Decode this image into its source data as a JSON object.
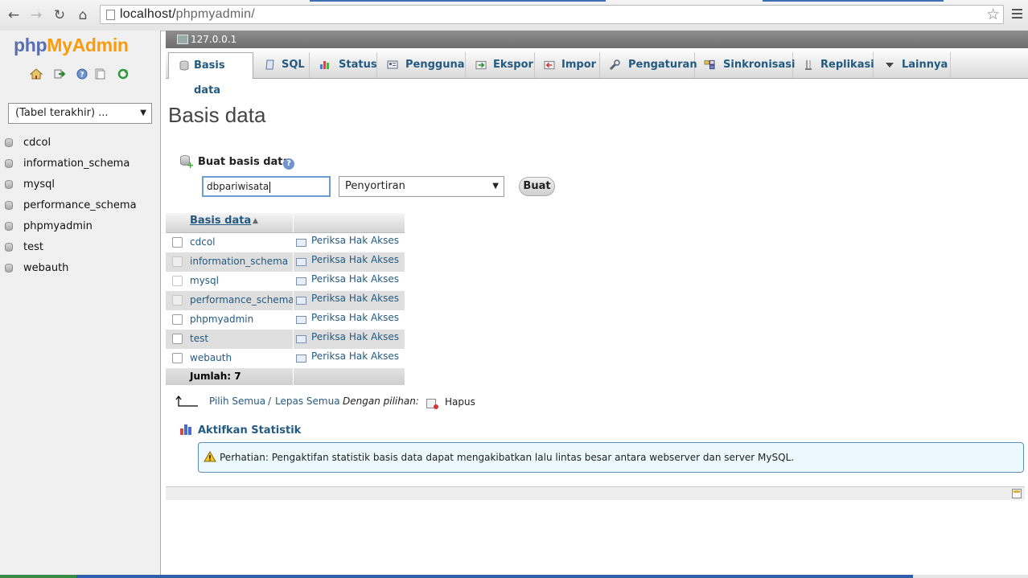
{
  "browser": {
    "url_host": "localhost/",
    "url_path": "phpmyadmin/"
  },
  "logo": {
    "php": "php",
    "my": "My",
    "admin": "Admin"
  },
  "sidebar": {
    "recent_select": "(Tabel terakhir) ...",
    "databases": [
      {
        "label": "cdcol"
      },
      {
        "label": "information_schema"
      },
      {
        "label": "mysql"
      },
      {
        "label": "performance_schema"
      },
      {
        "label": "phpmyadmin"
      },
      {
        "label": "test"
      },
      {
        "label": "webauth"
      }
    ]
  },
  "server": {
    "label": "127.0.0.1"
  },
  "tabs": [
    {
      "label": "Basis data",
      "active": true
    },
    {
      "label": "SQL"
    },
    {
      "label": "Status"
    },
    {
      "label": "Pengguna"
    },
    {
      "label": "Ekspor"
    },
    {
      "label": "Impor"
    },
    {
      "label": "Pengaturan"
    },
    {
      "label": "Sinkronisasi"
    },
    {
      "label": "Replikasi"
    },
    {
      "label": "Lainnya"
    }
  ],
  "page": {
    "title": "Basis data"
  },
  "create": {
    "heading": "Buat basis data",
    "name_value": "dbpariwisata",
    "collation": "Penyortiran",
    "button": "Buat"
  },
  "table": {
    "header": "Basis data",
    "rows": [
      {
        "name": "cdcol",
        "priv": "Periksa Hak Akses"
      },
      {
        "name": "information_schema",
        "priv": "Periksa Hak Akses"
      },
      {
        "name": "mysql",
        "priv": "Periksa Hak Akses"
      },
      {
        "name": "performance_schema",
        "priv": "Periksa Hak Akses"
      },
      {
        "name": "phpmyadmin",
        "priv": "Periksa Hak Akses"
      },
      {
        "name": "test",
        "priv": "Periksa Hak Akses"
      },
      {
        "name": "webauth",
        "priv": "Periksa Hak Akses"
      }
    ],
    "total": "Jumlah: 7"
  },
  "bulk": {
    "select_all": "Pilih Semua",
    "slash": "/",
    "deselect_all": "Lepas Semua",
    "with_selected": "Dengan pilihan:",
    "delete": "Hapus"
  },
  "stats": {
    "link": "Aktifkan Statistik",
    "notice": "Perhatian: Pengaktifan statistik basis data dapat mengakibatkan lalu lintas besar antara webserver dan server MySQL."
  }
}
